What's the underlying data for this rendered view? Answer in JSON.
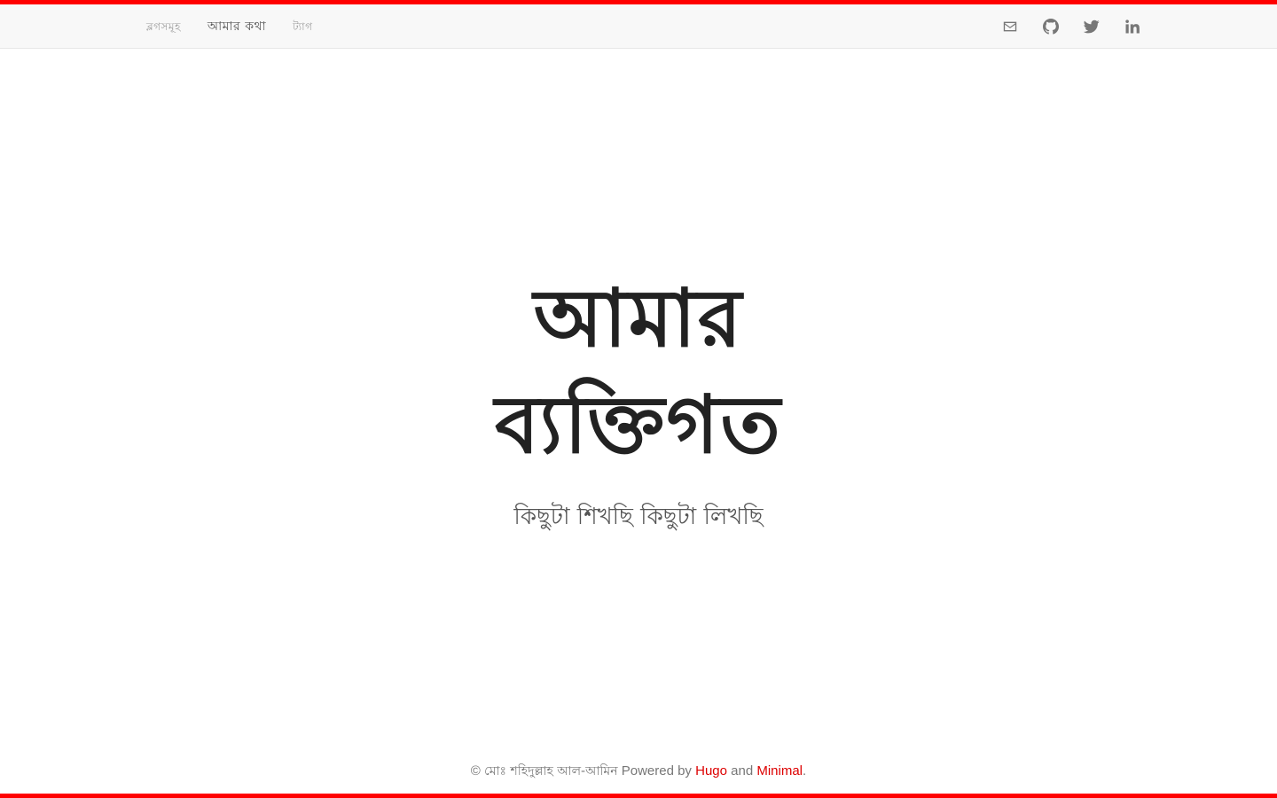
{
  "nav": {
    "links": [
      {
        "label": "ব্লগসমূহ",
        "active": false
      },
      {
        "label": "আমার কথা",
        "active": true
      },
      {
        "label": "ট্যাগ",
        "active": false
      }
    ],
    "social_icons": [
      "mail-icon",
      "github-icon",
      "twitter-icon",
      "linkedin-icon"
    ]
  },
  "hero": {
    "title_line1": "আমার",
    "title_line2": "ব্যক্তিগত",
    "subtitle": "কিছুটা শিখছি কিছুটা লিখছি"
  },
  "footer": {
    "copyright_symbol": "©",
    "owner": "মোঃ শহিদুল্লাহ আল-আমিন",
    "powered_by": "Powered by",
    "hugo_link": "Hugo",
    "and": "and",
    "minimal_link": "Minimal",
    "period": "."
  },
  "colors": {
    "accent": "#ff0000",
    "link": "#dd0000",
    "navbar_bg": "#f8f8f8",
    "title": "#222222",
    "text_muted": "#777777"
  }
}
